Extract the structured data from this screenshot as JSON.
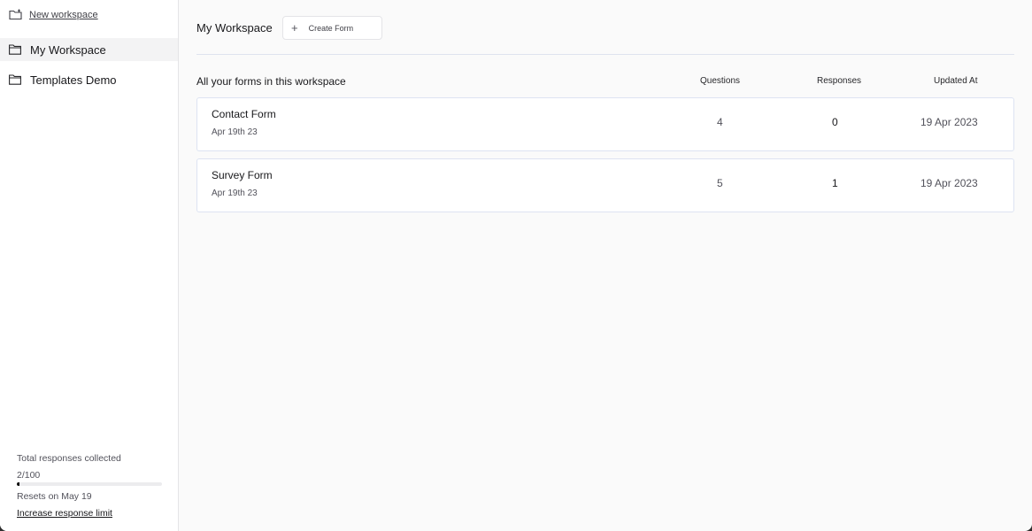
{
  "sidebar": {
    "new_workspace_label": "New workspace",
    "items": [
      {
        "label": "My Workspace",
        "active": true
      },
      {
        "label": "Templates Demo",
        "active": false
      }
    ],
    "usage": {
      "title": "Total responses collected",
      "count_text": "2/100",
      "progress_fraction": 0.02,
      "reset_text": "Resets on May 19",
      "link_label": "Increase response limit"
    }
  },
  "header": {
    "title": "My Workspace",
    "create_label": "Create Form"
  },
  "list": {
    "title": "All your forms in this workspace",
    "columns": [
      "Questions",
      "Responses",
      "Updated At"
    ],
    "rows": [
      {
        "name": "Contact Form",
        "created": "Apr 19th 23",
        "questions": "4",
        "responses": "0",
        "updated": "19 Apr 2023"
      },
      {
        "name": "Survey Form",
        "created": "Apr 19th 23",
        "questions": "5",
        "responses": "1",
        "updated": "19 Apr 2023"
      }
    ]
  }
}
